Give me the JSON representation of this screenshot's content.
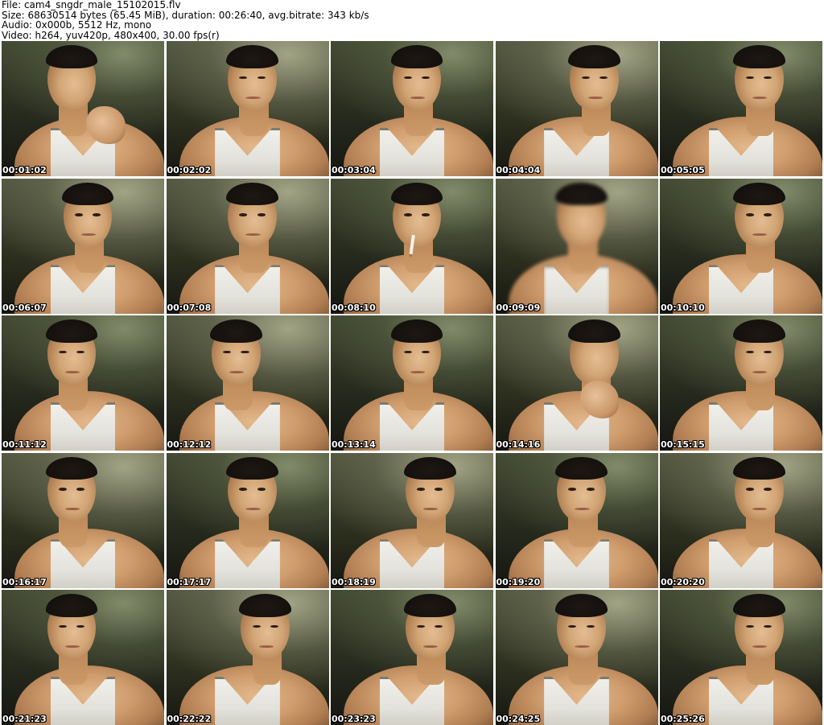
{
  "header": {
    "line_file": "File: cam4_sngdr_male_15102015.flv",
    "line_size": "Size: 68630514 bytes (65.45 MiB), duration: 00:26:40, avg.bitrate: 343 kb/s",
    "line_audio": "Audio: 0x000b, 5512 Hz, mono",
    "line_video": "Video: h264, yuv420p, 480x400, 30.00 fps(r)"
  },
  "thumbnails": [
    {
      "timestamp": "00:01:02"
    },
    {
      "timestamp": "00:02:02"
    },
    {
      "timestamp": "00:03:04"
    },
    {
      "timestamp": "00:04:04"
    },
    {
      "timestamp": "00:05:05"
    },
    {
      "timestamp": "00:06:07"
    },
    {
      "timestamp": "00:07:08"
    },
    {
      "timestamp": "00:08:10"
    },
    {
      "timestamp": "00:09:09"
    },
    {
      "timestamp": "00:10:10"
    },
    {
      "timestamp": "00:11:12"
    },
    {
      "timestamp": "00:12:12"
    },
    {
      "timestamp": "00:13:14"
    },
    {
      "timestamp": "00:14:16"
    },
    {
      "timestamp": "00:15:15"
    },
    {
      "timestamp": "00:16:17"
    },
    {
      "timestamp": "00:17:17"
    },
    {
      "timestamp": "00:18:19"
    },
    {
      "timestamp": "00:19:20"
    },
    {
      "timestamp": "00:20:20"
    },
    {
      "timestamp": "00:21:23"
    },
    {
      "timestamp": "00:22:22"
    },
    {
      "timestamp": "00:23:23"
    },
    {
      "timestamp": "00:24:25"
    },
    {
      "timestamp": "00:25:26"
    }
  ]
}
